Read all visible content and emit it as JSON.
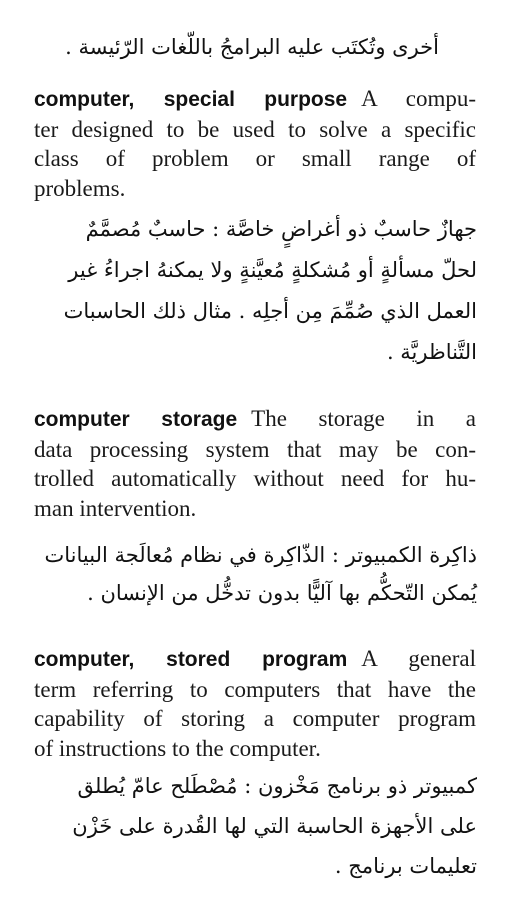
{
  "page": {
    "carryover_arabic": "أخرى وتُكتَب عليه البرامجُ باللّغات الرّئيسة ."
  },
  "entries": [
    {
      "term": "computer, special purpose",
      "definition_lines": [
        "A compu-",
        "ter designed to be used to solve a specific",
        "class of problem or small range of",
        "problems."
      ],
      "arabic_lines": [
        "جهازٌ حاسبٌ ذو أغراضٍ خاصَّة : حاسبٌ مُصمَّمٌ",
        "لحلّ مسألةٍ أو مُشكلةٍ مُعيَّنةٍ ولا يمكنهُ اجراءُ غير",
        "العمل الذي صُمِّمَ مِن أجلِه . مثال ذلك الحاسبات",
        "التَّناظريَّة ."
      ]
    },
    {
      "term": "computer storage",
      "definition_lines": [
        "The storage in a",
        "data processing system that may be con-",
        "trolled automatically without need for hu-",
        "man intervention."
      ],
      "arabic_lines": [
        "ذاكِرة الكمبيوتر : الذّاكِرة في نظام مُعالَجة البيانات",
        "يُمكن التّحكُّم بها آليًّا بدون تدخُّل من الإنسان ."
      ]
    },
    {
      "term": "computer, stored program",
      "definition_lines": [
        "A general",
        "term referring to computers that have the",
        "capability of storing a computer program",
        "of instructions to the computer."
      ],
      "arabic_lines": [
        "كمبيوتر ذو برنامج مَخْزون : مُصْطَلح عامّ يُطلق",
        "على الأجهزة الحاسبة التي لها القُدرة على خَزْن",
        "تعليمات برنامج ."
      ]
    }
  ]
}
